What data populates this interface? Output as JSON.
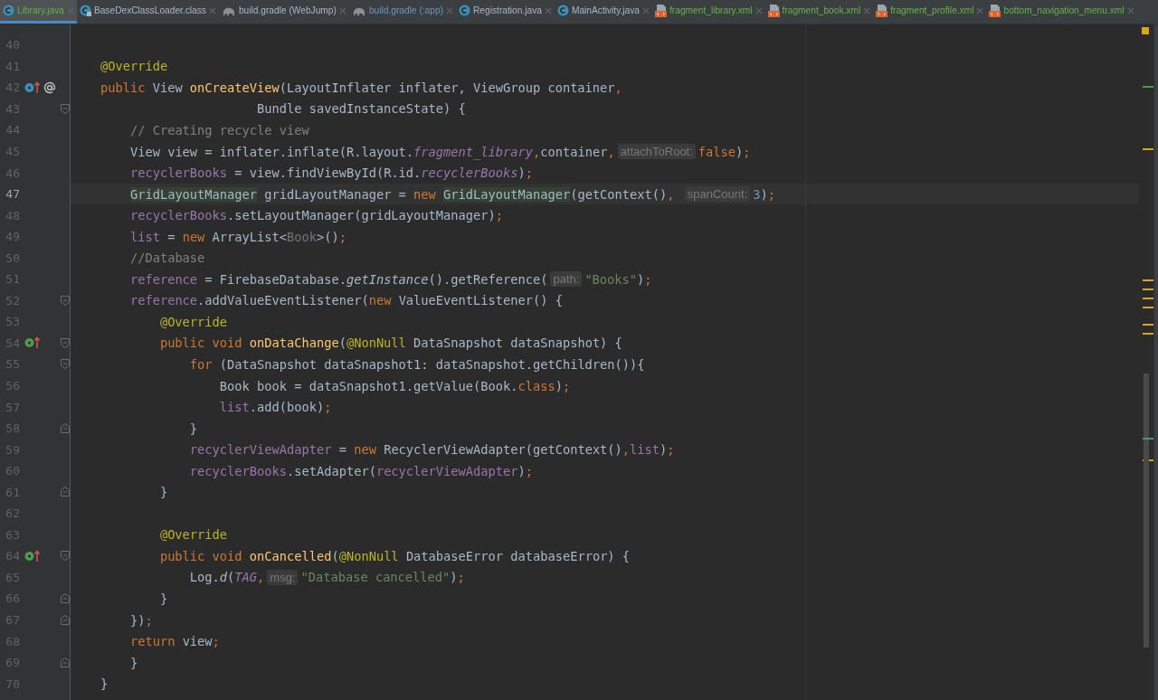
{
  "tabs": [
    {
      "label": "Library.java",
      "kind": "class",
      "color": "#62b543",
      "selected": true
    },
    {
      "label": "BaseDexClassLoader.class",
      "kind": "class-locked",
      "color": "#a9b7c6",
      "selected": false
    },
    {
      "label": "build.gradle (WebJump)",
      "kind": "gradle",
      "color": "#a9b7c6",
      "selected": false
    },
    {
      "label": "build.gradle (:app)",
      "kind": "gradle",
      "color": "#6897bb",
      "selected": false
    },
    {
      "label": "Registration.java",
      "kind": "class",
      "color": "#a9b7c6",
      "selected": false
    },
    {
      "label": "MainActivity.java",
      "kind": "class",
      "color": "#a9b7c6",
      "selected": false
    },
    {
      "label": "fragment_library.xml",
      "kind": "xml",
      "color": "#62b543",
      "selected": false
    },
    {
      "label": "fragment_book.xml",
      "kind": "xml",
      "color": "#62b543",
      "selected": false
    },
    {
      "label": "fragment_profile.xml",
      "kind": "xml",
      "color": "#62b543",
      "selected": false
    },
    {
      "label": "bottom_navigation_menu.xml",
      "kind": "xml",
      "color": "#62b543",
      "selected": false
    }
  ],
  "lines": [
    {
      "number": "40",
      "current": false
    },
    {
      "number": "41",
      "current": false,
      "tokens": [
        {
          "kind": "ann",
          "text": "    @Override"
        }
      ]
    },
    {
      "number": "42",
      "current": false,
      "gutter": [
        {
          "kind": "override"
        },
        {
          "kind": "at"
        }
      ],
      "tokens": [
        {
          "kind": "kw",
          "text": "    public "
        },
        {
          "kind": "p",
          "text": "View "
        },
        {
          "kind": "md",
          "text": "onCreateView"
        },
        {
          "kind": "p",
          "text": "(LayoutInflater inflater, ViewGroup container"
        },
        {
          "kind": "kw",
          "text": ","
        }
      ]
    },
    {
      "number": "43",
      "current": false,
      "fold": {
        "kind": "start"
      },
      "tokens": [
        {
          "kind": "p",
          "text": "                         Bundle savedInstanceState) {"
        }
      ]
    },
    {
      "number": "44",
      "current": false,
      "tokens": [
        {
          "kind": "c",
          "text": "        // Creating recycle view"
        }
      ]
    },
    {
      "number": "45",
      "current": false,
      "tokens": [
        {
          "kind": "p",
          "text": "        View view = inflater.inflate(R.layout."
        },
        {
          "kind": "sf",
          "text": "fragment_library"
        },
        {
          "kind": "kw",
          "text": ","
        },
        {
          "kind": "p",
          "text": "container"
        },
        {
          "kind": "kw",
          "text": ","
        },
        {
          "kind": "hint",
          "text": "attachToRoot:"
        },
        {
          "kind": "kw",
          "text": "false"
        },
        {
          "kind": "p",
          "text": ")"
        },
        {
          "kind": "kw",
          "text": ";"
        }
      ]
    },
    {
      "number": "46",
      "current": false,
      "tokens": [
        {
          "kind": "f",
          "text": "        recyclerBooks"
        },
        {
          "kind": "p",
          "text": " = view.findViewById(R.id."
        },
        {
          "kind": "sf",
          "text": "recyclerBooks"
        },
        {
          "kind": "p",
          "text": ")"
        },
        {
          "kind": "kw",
          "text": ";"
        }
      ]
    },
    {
      "number": "47",
      "current": true,
      "tokens": [
        {
          "kind": "hl",
          "text": "        GridLayoutManager"
        },
        {
          "kind": "p",
          "text": " gridLayoutManager = "
        },
        {
          "kind": "kw",
          "text": "new "
        },
        {
          "kind": "hl",
          "text": "GridLayoutManager"
        },
        {
          "kind": "p",
          "text": "(getContext()"
        },
        {
          "kind": "kw",
          "text": ", "
        },
        {
          "kind": "hint",
          "text": "spanCount:"
        },
        {
          "kind": "num",
          "text": "3"
        },
        {
          "kind": "p",
          "text": ")"
        },
        {
          "kind": "kw",
          "text": ";"
        }
      ]
    },
    {
      "number": "48",
      "current": false,
      "tokens": [
        {
          "kind": "f",
          "text": "        recyclerBooks"
        },
        {
          "kind": "p",
          "text": ".setLayoutManager(gridLayoutManager)"
        },
        {
          "kind": "kw",
          "text": ";"
        }
      ]
    },
    {
      "number": "49",
      "current": false,
      "tokens": [
        {
          "kind": "f",
          "text": "        list"
        },
        {
          "kind": "p",
          "text": " = "
        },
        {
          "kind": "kw",
          "text": "new "
        },
        {
          "kind": "p",
          "text": "ArrayList<"
        },
        {
          "kind": "dim",
          "text": "Book"
        },
        {
          "kind": "p",
          "text": ">()"
        },
        {
          "kind": "kw",
          "text": ";"
        }
      ]
    },
    {
      "number": "50",
      "current": false,
      "tokens": [
        {
          "kind": "c",
          "text": "        //Database"
        }
      ]
    },
    {
      "number": "51",
      "current": false,
      "tokens": [
        {
          "kind": "f",
          "text": "        reference"
        },
        {
          "kind": "p",
          "text": " = FirebaseDatabase."
        },
        {
          "kind": "si",
          "text": "getInstance"
        },
        {
          "kind": "p",
          "text": "().getReference("
        },
        {
          "kind": "hint",
          "text": "path:"
        },
        {
          "kind": "str",
          "text": "\"Books\""
        },
        {
          "kind": "p",
          "text": ")"
        },
        {
          "kind": "kw",
          "text": ";"
        }
      ]
    },
    {
      "number": "52",
      "current": false,
      "fold": {
        "kind": "start"
      },
      "tokens": [
        {
          "kind": "f",
          "text": "        reference"
        },
        {
          "kind": "p",
          "text": ".addValueEventListener("
        },
        {
          "kind": "kw",
          "text": "new "
        },
        {
          "kind": "p",
          "text": "ValueEventListener() {"
        }
      ]
    },
    {
      "number": "53",
      "current": false,
      "tokens": [
        {
          "kind": "ann",
          "text": "            @Override"
        }
      ]
    },
    {
      "number": "54",
      "current": false,
      "gutter": [
        {
          "kind": "implement"
        }
      ],
      "fold": {
        "kind": "start"
      },
      "tokens": [
        {
          "kind": "kw",
          "text": "            public void "
        },
        {
          "kind": "md",
          "text": "onDataChange"
        },
        {
          "kind": "p",
          "text": "("
        },
        {
          "kind": "ann",
          "text": "@NonNull"
        },
        {
          "kind": "p",
          "text": " DataSnapshot dataSnapshot) {"
        }
      ]
    },
    {
      "number": "55",
      "current": false,
      "fold": {
        "kind": "start"
      },
      "tokens": [
        {
          "kind": "kw",
          "text": "                for "
        },
        {
          "kind": "p",
          "text": "(DataSnapshot dataSnapshot1: dataSnapshot.getChildren()){"
        }
      ]
    },
    {
      "number": "56",
      "current": false,
      "tokens": [
        {
          "kind": "p",
          "text": "                    Book book = dataSnapshot1.getValue(Book."
        },
        {
          "kind": "kw",
          "text": "class"
        },
        {
          "kind": "p",
          "text": ")"
        },
        {
          "kind": "kw",
          "text": ";"
        }
      ]
    },
    {
      "number": "57",
      "current": false,
      "tokens": [
        {
          "kind": "f",
          "text": "                    list"
        },
        {
          "kind": "p",
          "text": ".add(book)"
        },
        {
          "kind": "kw",
          "text": ";"
        }
      ]
    },
    {
      "number": "58",
      "current": false,
      "fold": {
        "kind": "end"
      },
      "tokens": [
        {
          "kind": "p",
          "text": "                }"
        }
      ]
    },
    {
      "number": "59",
      "current": false,
      "tokens": [
        {
          "kind": "f",
          "text": "                recyclerViewAdapter"
        },
        {
          "kind": "p",
          "text": " = "
        },
        {
          "kind": "kw",
          "text": "new "
        },
        {
          "kind": "p",
          "text": "RecyclerViewAdapter(getContext()"
        },
        {
          "kind": "kw",
          "text": ","
        },
        {
          "kind": "f",
          "text": "list"
        },
        {
          "kind": "p",
          "text": ")"
        },
        {
          "kind": "kw",
          "text": ";"
        }
      ]
    },
    {
      "number": "60",
      "current": false,
      "tokens": [
        {
          "kind": "f",
          "text": "                recyclerBooks"
        },
        {
          "kind": "p",
          "text": ".setAdapter("
        },
        {
          "kind": "f",
          "text": "recyclerViewAdapter"
        },
        {
          "kind": "p",
          "text": ")"
        },
        {
          "kind": "kw",
          "text": ";"
        }
      ]
    },
    {
      "number": "61",
      "current": false,
      "fold": {
        "kind": "end"
      },
      "tokens": [
        {
          "kind": "p",
          "text": "            }"
        }
      ]
    },
    {
      "number": "62",
      "current": false
    },
    {
      "number": "63",
      "current": false,
      "tokens": [
        {
          "kind": "ann",
          "text": "            @Override"
        }
      ]
    },
    {
      "number": "64",
      "current": false,
      "gutter": [
        {
          "kind": "implement"
        }
      ],
      "fold": {
        "kind": "start"
      },
      "tokens": [
        {
          "kind": "kw",
          "text": "            public void "
        },
        {
          "kind": "md",
          "text": "onCancelled"
        },
        {
          "kind": "p",
          "text": "("
        },
        {
          "kind": "ann",
          "text": "@NonNull"
        },
        {
          "kind": "p",
          "text": " DatabaseError databaseError) {"
        }
      ]
    },
    {
      "number": "65",
      "current": false,
      "tokens": [
        {
          "kind": "p",
          "text": "                Log."
        },
        {
          "kind": "si",
          "text": "d"
        },
        {
          "kind": "p",
          "text": "("
        },
        {
          "kind": "sf",
          "text": "TAG"
        },
        {
          "kind": "kw",
          "text": ","
        },
        {
          "kind": "hint",
          "text": "msg:"
        },
        {
          "kind": "str",
          "text": "\"Database cancelled\""
        },
        {
          "kind": "p",
          "text": ")"
        },
        {
          "kind": "kw",
          "text": ";"
        }
      ]
    },
    {
      "number": "66",
      "current": false,
      "fold": {
        "kind": "end"
      },
      "tokens": [
        {
          "kind": "p",
          "text": "            }"
        }
      ]
    },
    {
      "number": "67",
      "current": false,
      "fold": {
        "kind": "end"
      },
      "tokens": [
        {
          "kind": "p",
          "text": "        })"
        },
        {
          "kind": "kw",
          "text": ";"
        }
      ]
    },
    {
      "number": "68",
      "current": false,
      "tokens": [
        {
          "kind": "kw",
          "text": "        return "
        },
        {
          "kind": "p",
          "text": "view"
        },
        {
          "kind": "kw",
          "text": ";"
        }
      ]
    },
    {
      "number": "69",
      "current": false,
      "fold": {
        "kind": "end"
      },
      "tokens": [
        {
          "kind": "p",
          "text": "        }"
        }
      ]
    },
    {
      "number": "70",
      "current": false,
      "tokens": [
        {
          "kind": "p",
          "text": "    }"
        }
      ]
    }
  ]
}
